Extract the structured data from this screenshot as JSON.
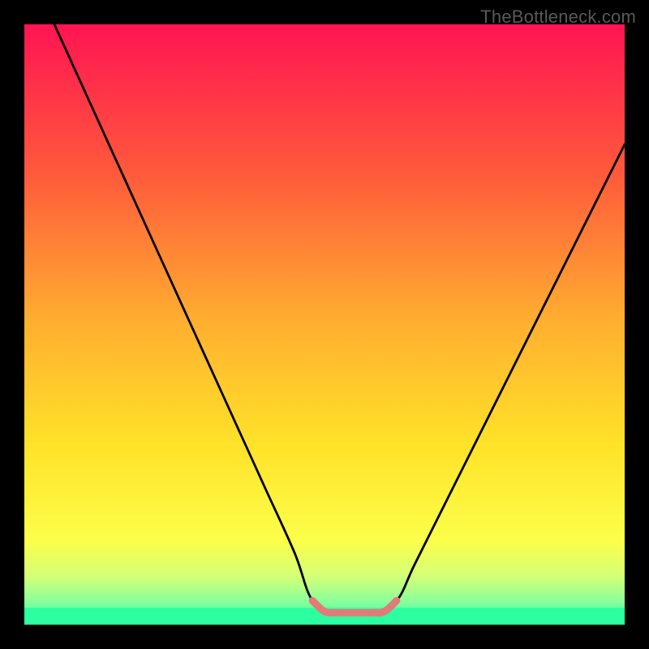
{
  "attribution": "TheBottleneck.com",
  "chart_data": {
    "type": "line",
    "title": "",
    "xlabel": "",
    "ylabel": "",
    "xlim": [
      0,
      100
    ],
    "ylim": [
      0,
      100
    ],
    "series": [
      {
        "name": "main-curve",
        "color": "#000000",
        "x": [
          5,
          10,
          15,
          20,
          25,
          30,
          35,
          40,
          45,
          48,
          52,
          55,
          58,
          62,
          65,
          70,
          75,
          80,
          85,
          90,
          95,
          100
        ],
        "y": [
          100,
          89,
          78,
          67,
          56,
          45,
          34,
          23,
          12,
          4,
          2,
          2,
          2,
          4,
          10,
          20,
          30,
          40,
          50,
          60,
          70,
          80
        ]
      },
      {
        "name": "optimal-zone",
        "color": "#e47a77",
        "x": [
          48,
          50,
          52,
          54,
          56,
          58,
          60,
          62
        ],
        "y": [
          4,
          2.2,
          2,
          2,
          2,
          2,
          2.2,
          4
        ]
      }
    ],
    "background_gradient_stops": [
      {
        "offset": 0.0,
        "color": "#ff1452"
      },
      {
        "offset": 0.25,
        "color": "#ff5a3b"
      },
      {
        "offset": 0.5,
        "color": "#ffb030"
      },
      {
        "offset": 0.7,
        "color": "#ffe229"
      },
      {
        "offset": 0.86,
        "color": "#fcff4a"
      },
      {
        "offset": 0.92,
        "color": "#d3ff77"
      },
      {
        "offset": 0.96,
        "color": "#8cff9a"
      },
      {
        "offset": 1.0,
        "color": "#2bffa0"
      }
    ],
    "optimal_zone_height": 0.028
  }
}
